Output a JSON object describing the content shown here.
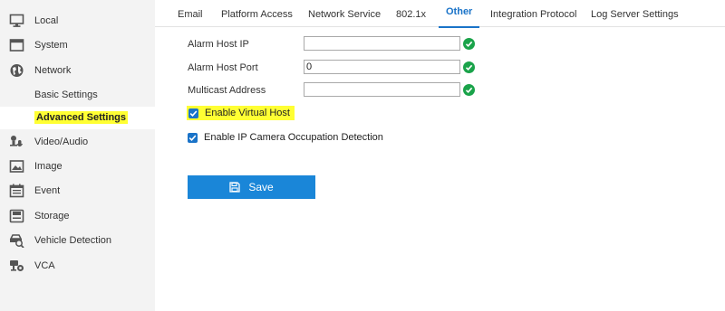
{
  "sidebar": {
    "items": [
      {
        "label": "Local",
        "icon": "monitor-icon"
      },
      {
        "label": "System",
        "icon": "window-icon"
      },
      {
        "label": "Network",
        "icon": "globe-icon"
      },
      {
        "label": "Basic Settings"
      },
      {
        "label": "Advanced Settings",
        "active": true
      },
      {
        "label": "Video/Audio",
        "icon": "camera-mic-icon"
      },
      {
        "label": "Image",
        "icon": "image-icon"
      },
      {
        "label": "Event",
        "icon": "calendar-icon"
      },
      {
        "label": "Storage",
        "icon": "disk-icon"
      },
      {
        "label": "Vehicle Detection",
        "icon": "vehicle-search-icon"
      },
      {
        "label": "VCA",
        "icon": "vca-camera-icon"
      }
    ]
  },
  "tabs": [
    {
      "label": "Email"
    },
    {
      "label": "Platform Access"
    },
    {
      "label": "Network Service"
    },
    {
      "label": "802.1x"
    },
    {
      "label": "Other",
      "active": true
    },
    {
      "label": "Integration Protocol"
    },
    {
      "label": "Log Server Settings"
    }
  ],
  "form": {
    "alarm_host_ip": {
      "label": "Alarm Host IP",
      "value": ""
    },
    "alarm_host_port": {
      "label": "Alarm Host Port",
      "value": "0"
    },
    "multicast_address": {
      "label": "Multicast Address",
      "value": ""
    },
    "enable_virtual_host": {
      "label": "Enable Virtual Host",
      "checked": true
    },
    "enable_ip_camera_occupation": {
      "label": "Enable IP Camera Occupation Detection",
      "checked": true
    }
  },
  "save_label": "Save",
  "colors": {
    "accent": "#1a73c8",
    "save_button": "#1a86d8",
    "valid": "#1aa34a",
    "highlight": "#ffff33",
    "sidebar_bg": "#f3f3f3"
  }
}
